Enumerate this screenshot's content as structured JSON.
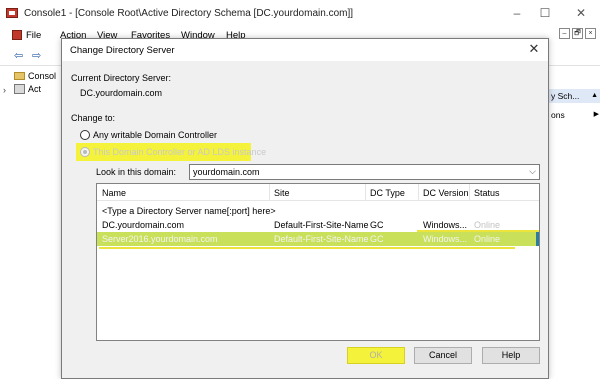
{
  "window": {
    "title": "Console1 - [Console Root\\Active Directory Schema [DC.yourdomain.com]]",
    "minimize": "–",
    "maximize": "☐",
    "close": "✕"
  },
  "menubar": {
    "items": [
      "File",
      "Action",
      "View",
      "Favorites",
      "Window",
      "Help"
    ],
    "inner_controls": [
      "–",
      "🗗",
      "×"
    ]
  },
  "toolbar": {
    "back": "⇦",
    "forward": "⇨"
  },
  "tree": {
    "items": [
      {
        "label": "Consol"
      },
      {
        "label": "Act"
      }
    ]
  },
  "actions": {
    "header": "y Sch...",
    "item": "ons"
  },
  "dialog": {
    "title": "Change Directory Server",
    "close": "✕",
    "current_server_label": "Current Directory Server:",
    "current_server_value": "DC.yourdomain.com",
    "change_to_label": "Change to:",
    "options": [
      {
        "label": "Any writable Domain Controller",
        "selected": false,
        "enabled": true
      },
      {
        "label": "This Domain Controller or AD LDS instance",
        "selected": true,
        "enabled": false
      }
    ],
    "look_in_label": "Look in this domain:",
    "domain_value": "yourdomain.com",
    "list": {
      "columns": [
        "Name",
        "Site",
        "DC Type",
        "DC Version",
        "Status"
      ],
      "rows": [
        {
          "name": "<Type a Directory Server name[:port] here>",
          "site": "",
          "dc_type": "",
          "dc_version": "",
          "status": ""
        },
        {
          "name": "DC.yourdomain.com",
          "site": "Default-First-Site-Name",
          "dc_type": "GC",
          "dc_version": "Windows...",
          "status": "Online"
        },
        {
          "name": "Server2016.yourdomain.com",
          "site": "Default-First-Site-Name",
          "dc_type": "GC",
          "dc_version": "Windows...",
          "status": "Online",
          "selected": true
        }
      ]
    },
    "buttons": {
      "ok": "OK",
      "cancel": "Cancel",
      "help": "Help"
    }
  },
  "colors": {
    "highlight": "#f4f23a",
    "selection": "#c9e05a",
    "dialog_bg": "#f0f0f0"
  }
}
